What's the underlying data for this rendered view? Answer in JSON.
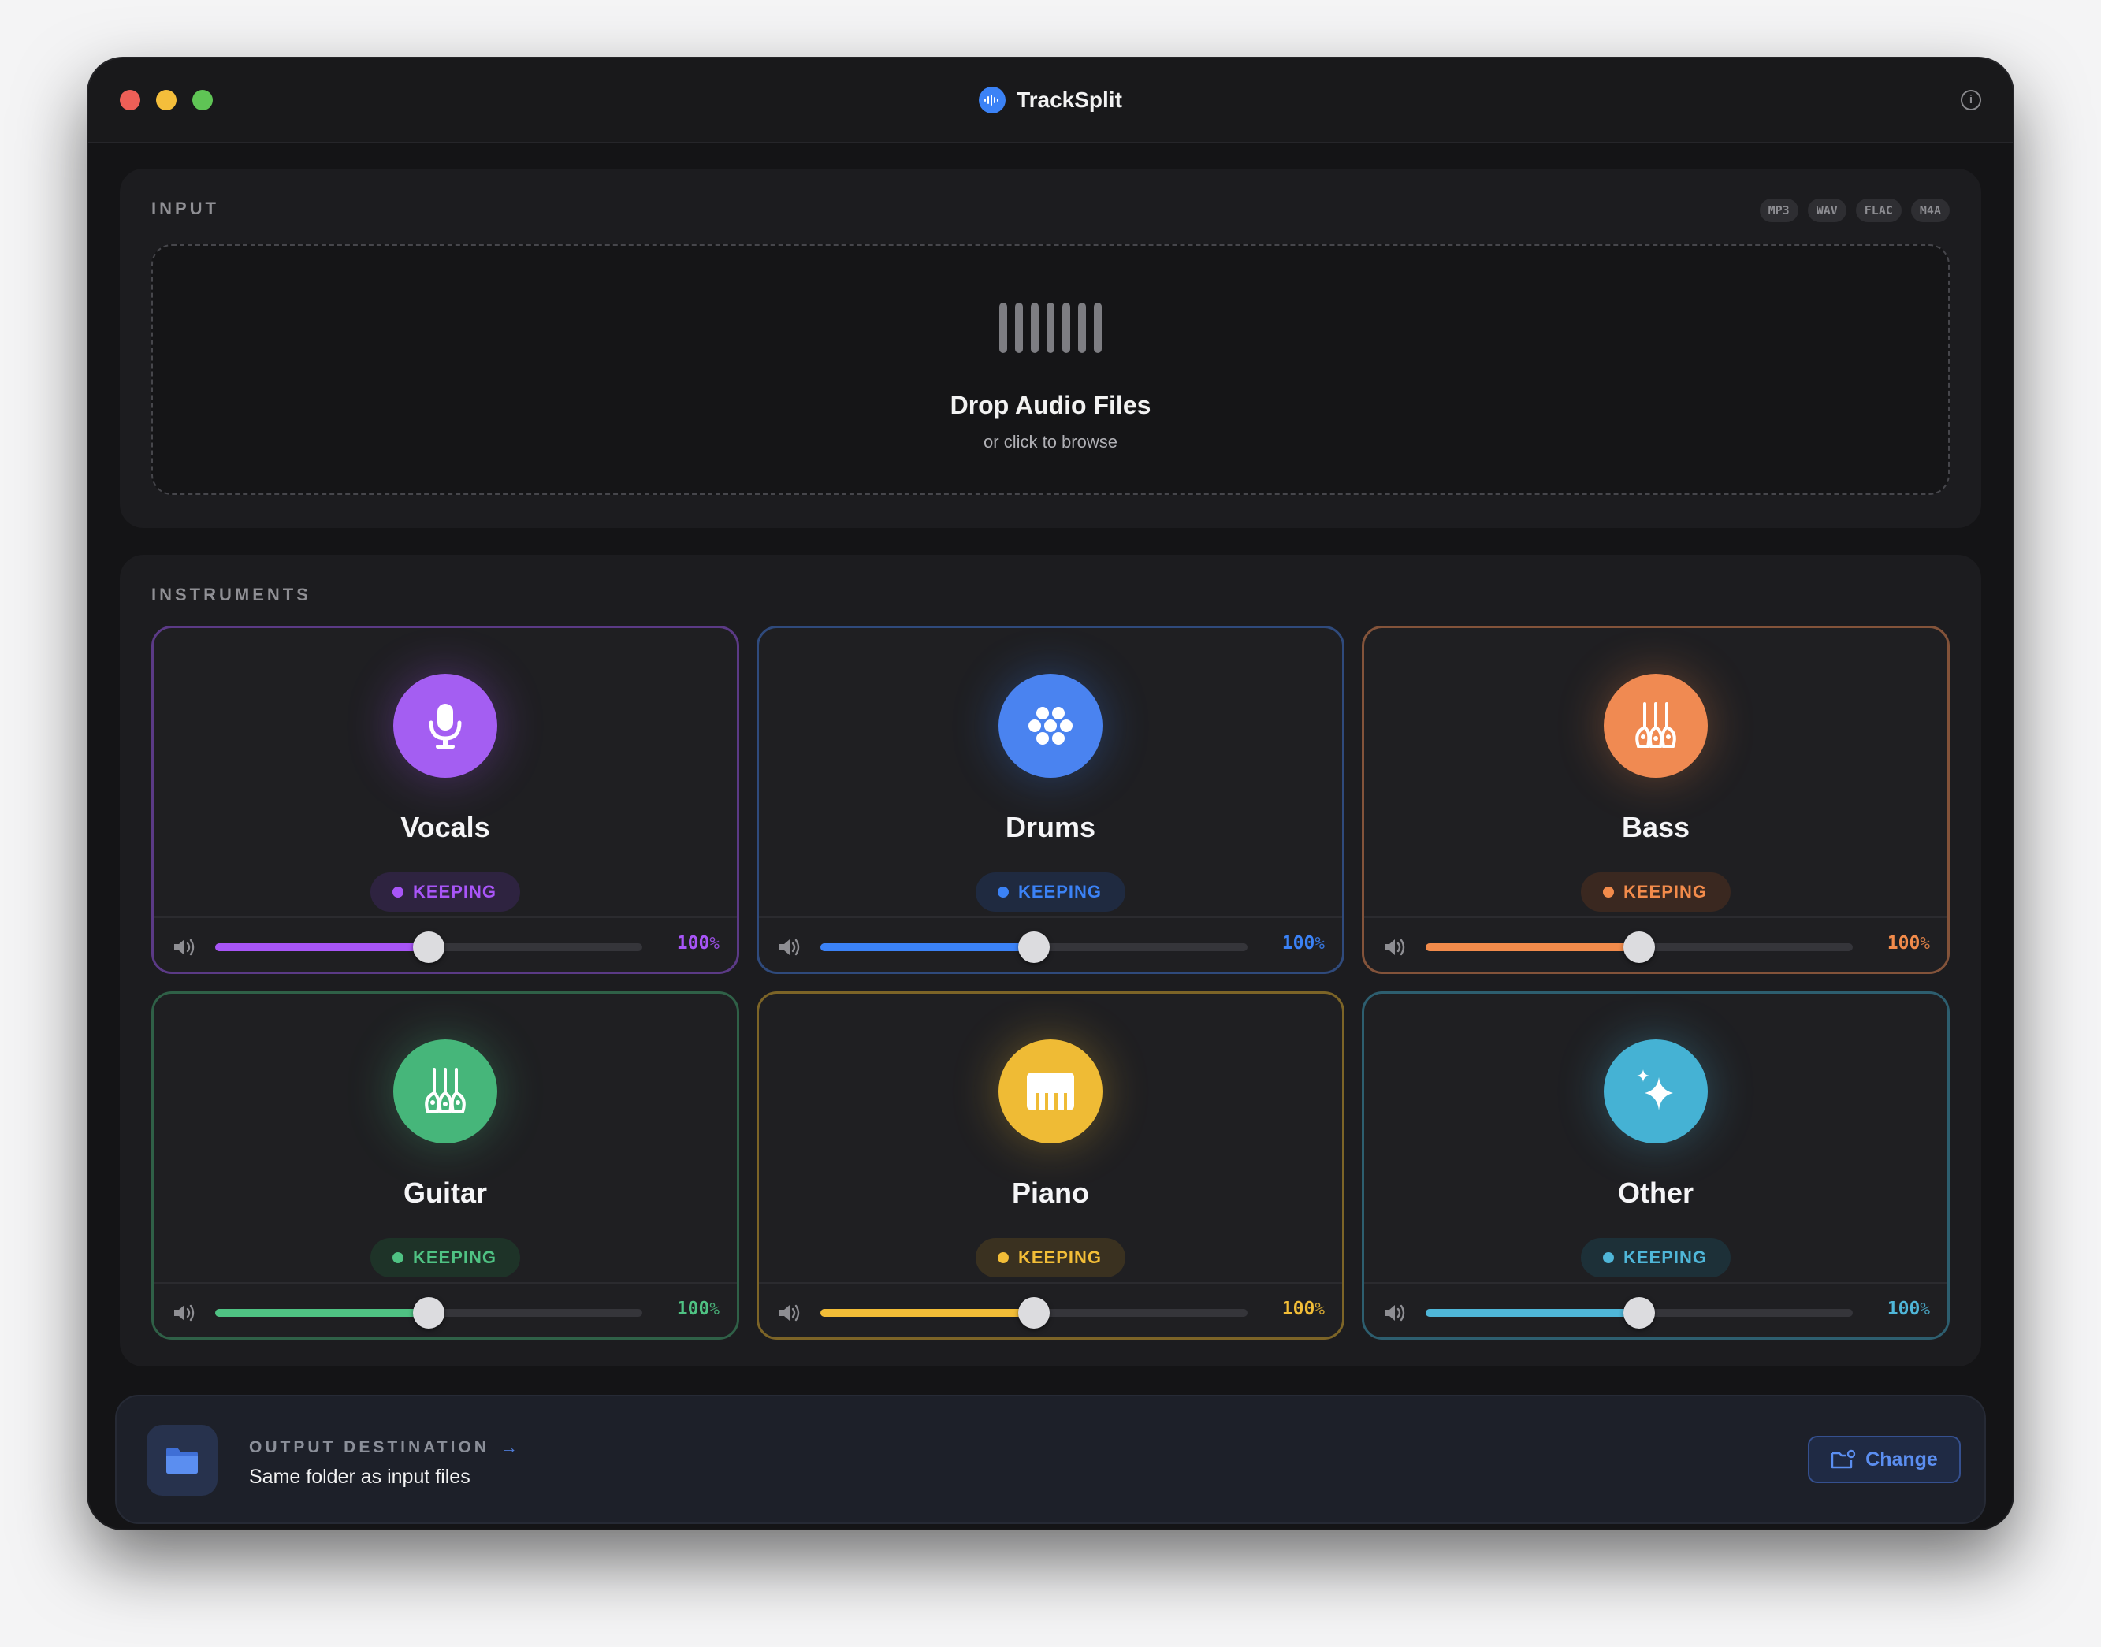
{
  "app": {
    "title": "TrackSplit",
    "info_icon": "info-icon",
    "app_icon": "waveform-icon"
  },
  "input": {
    "section_label": "INPUT",
    "formats": [
      "MP3",
      "WAV",
      "FLAC",
      "M4A"
    ],
    "drop_title": "Drop Audio Files",
    "drop_subtitle": "or click to browse"
  },
  "instruments": {
    "section_label": "INSTRUMENTS",
    "cards": [
      {
        "name": "Vocals",
        "icon": "microphone-icon",
        "status": "KEEPING",
        "volume": "100",
        "volume_unit": "%",
        "slider_level": 0.5,
        "color": "#a855f7",
        "icon_bg": "#a45ef2",
        "badge_bg": "#2e2340",
        "border": "#5b3a86"
      },
      {
        "name": "Drums",
        "icon": "drum-pads-icon",
        "status": "KEEPING",
        "volume": "100",
        "volume_unit": "%",
        "slider_level": 0.5,
        "color": "#3b82f6",
        "icon_bg": "#4a83f0",
        "badge_bg": "#1f2a40",
        "border": "#2f4a7c"
      },
      {
        "name": "Bass",
        "icon": "guitars-icon",
        "status": "KEEPING",
        "volume": "100",
        "volume_unit": "%",
        "slider_level": 0.5,
        "color": "#f28b4b",
        "icon_bg": "#f08a52",
        "badge_bg": "#3a2820",
        "border": "#83533a"
      },
      {
        "name": "Guitar",
        "icon": "guitars-icon",
        "status": "KEEPING",
        "volume": "100",
        "volume_unit": "%",
        "slider_level": 0.5,
        "color": "#4fc283",
        "icon_bg": "#46b67a",
        "badge_bg": "#1e3328",
        "border": "#2f6047"
      },
      {
        "name": "Piano",
        "icon": "piano-keys-icon",
        "status": "KEEPING",
        "volume": "100",
        "volume_unit": "%",
        "slider_level": 0.5,
        "color": "#f2bd37",
        "icon_bg": "#efbb35",
        "badge_bg": "#3a3120",
        "border": "#7c6427"
      },
      {
        "name": "Other",
        "icon": "sparkles-icon",
        "status": "KEEPING",
        "volume": "100",
        "volume_unit": "%",
        "slider_level": 0.5,
        "color": "#4fb6d8",
        "icon_bg": "#45b2d4",
        "badge_bg": "#1d3038",
        "border": "#2d5e6f"
      }
    ]
  },
  "output": {
    "label": "OUTPUT DESTINATION",
    "arrow": "→",
    "value": "Same folder as input files",
    "change_label": "Change",
    "folder_icon": "folder-icon",
    "change_icon": "folder-badge-icon"
  }
}
